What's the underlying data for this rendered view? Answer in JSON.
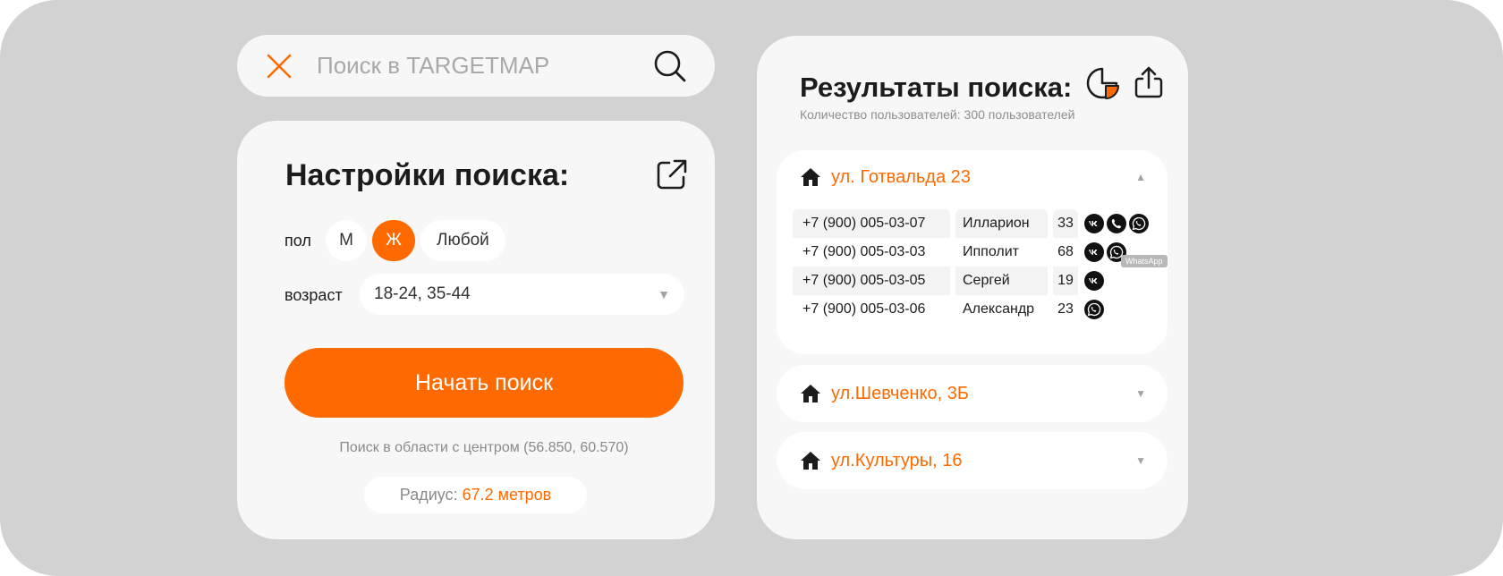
{
  "search": {
    "placeholder": "Поиск в TARGETMAP"
  },
  "settings": {
    "title": "Настройки поиска:",
    "gender_label": "пол",
    "gender_options": [
      "М",
      "Ж",
      "Любой"
    ],
    "gender_selected": "Ж",
    "age_label": "возраст",
    "age_value": "18-24, 35-44",
    "start_label": "Начать поиск",
    "area_note": "Поиск в области с центром (56.850, 60.570)",
    "radius_prefix": "Радиус:",
    "radius_value": "67.2 метров"
  },
  "results": {
    "title": "Результаты поиска:",
    "count_text": "Количество пользователей: 300 пользователей",
    "addresses": [
      {
        "label": "ул. Готвальда 23",
        "expanded": true,
        "rows": [
          {
            "phone": "+7 (900) 005-03-07",
            "name": "Илларион",
            "age": "33",
            "icons": [
              "vk-icon",
              "viber-icon",
              "whatsapp-icon"
            ]
          },
          {
            "phone": "+7 (900) 005-03-03",
            "name": "Ипполит",
            "age": "68",
            "icons": [
              "vk-icon",
              "whatsapp-icon"
            ]
          },
          {
            "phone": "+7 (900) 005-03-05",
            "name": "Сергей",
            "age": "19",
            "icons": [
              "vk-icon"
            ]
          },
          {
            "phone": "+7 (900) 005-03-06",
            "name": "Александр",
            "age": "23",
            "icons": [
              "whatsapp-icon"
            ]
          }
        ]
      },
      {
        "label": "ул.Шевченко, 3Б",
        "expanded": false
      },
      {
        "label": "ул.Культуры, 16",
        "expanded": false
      }
    ],
    "tooltip": "WhatsApp"
  },
  "colors": {
    "accent": "#ff6a00",
    "background": "#d2d2d2",
    "card": "#f7f7f7",
    "text": "#1c1c1c",
    "muted": "#8a8a8a"
  }
}
